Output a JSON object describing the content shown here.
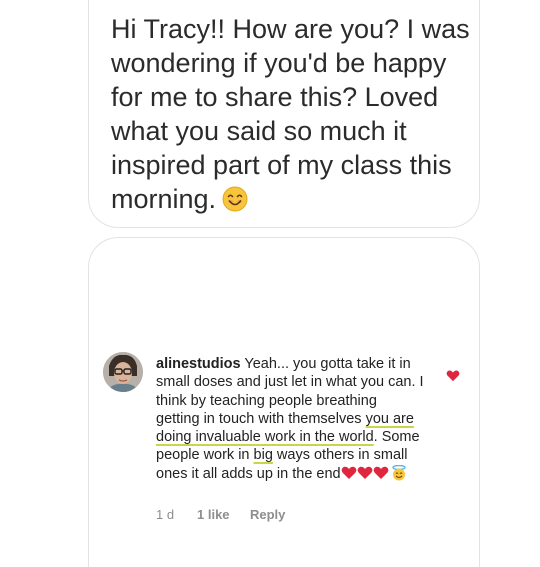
{
  "message": {
    "text": "Hi Tracy!! How are you? I was wondering if you'd be happy for me to share this? Loved what you said so much it inspired part of my class this morning.",
    "emoji": "smiling-face-emoji"
  },
  "comment": {
    "username": "alinestudios",
    "text_before": " Yeah... you gotta take it in small doses and just let in what you can.  I think by teaching people breathing getting in touch with themselves ",
    "highlight_1": "you are doing invaluable work in the world",
    "text_mid": ".  Some people work in ",
    "highlight_2": "big",
    "text_after": " ways others in small ones it all adds up in the end",
    "emojis": [
      "red-heart",
      "red-heart",
      "red-heart",
      "smiling-face-with-halo"
    ],
    "time": "1 d",
    "likes": "1 like",
    "reply": "Reply"
  },
  "colors": {
    "heart": "#e0263f",
    "highlight_underline": "#c9d64a",
    "emoji_yellow": "#f7c43a"
  }
}
